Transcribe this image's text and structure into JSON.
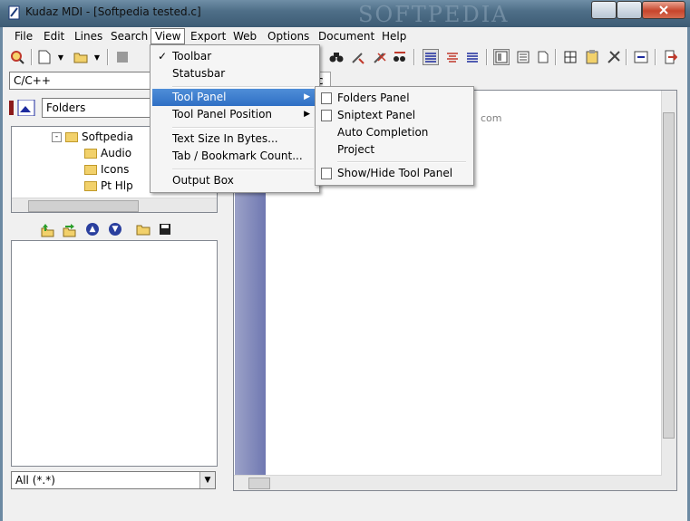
{
  "window": {
    "title": "Kudaz MDI - [Softpedia tested.c]",
    "watermark": "SOFTPEDIA"
  },
  "menubar": {
    "items": [
      "File",
      "Edit",
      "Lines",
      "Search",
      "View",
      "Export",
      "Web",
      "Options",
      "Document",
      "Help"
    ]
  },
  "left_panel": {
    "language": "C/C++",
    "folder_view": "Folders",
    "tree": [
      {
        "label": "Softpedia",
        "expander": "-"
      },
      {
        "label": "Audio"
      },
      {
        "label": "Icons"
      },
      {
        "label": "Pt Hlp"
      }
    ],
    "filter": "All (*.*)"
  },
  "editor": {
    "tab_label": "c",
    "ghost_text": "com"
  },
  "view_menu": {
    "items": [
      {
        "label": "Toolbar",
        "checked": "✓"
      },
      {
        "label": "Statusbar"
      },
      {
        "label": "Tool Panel",
        "submenu_arrow": "▶"
      },
      {
        "label": "Tool Panel Position",
        "submenu_arrow": "▶"
      },
      {
        "label": "Text Size In Bytes..."
      },
      {
        "label": "Tab / Bookmark Count..."
      },
      {
        "label": "Output Box"
      }
    ]
  },
  "tool_panel_submenu": {
    "items": [
      {
        "label": "Folders Panel"
      },
      {
        "label": "Sniptext Panel"
      },
      {
        "label": "Auto Completion"
      },
      {
        "label": "Project"
      },
      {
        "label": "Show/Hide Tool Panel"
      }
    ]
  },
  "colors": {
    "highlight": "#2f6fc4",
    "gutter": "#6f78b1",
    "title_bar": "#4f6f88"
  }
}
